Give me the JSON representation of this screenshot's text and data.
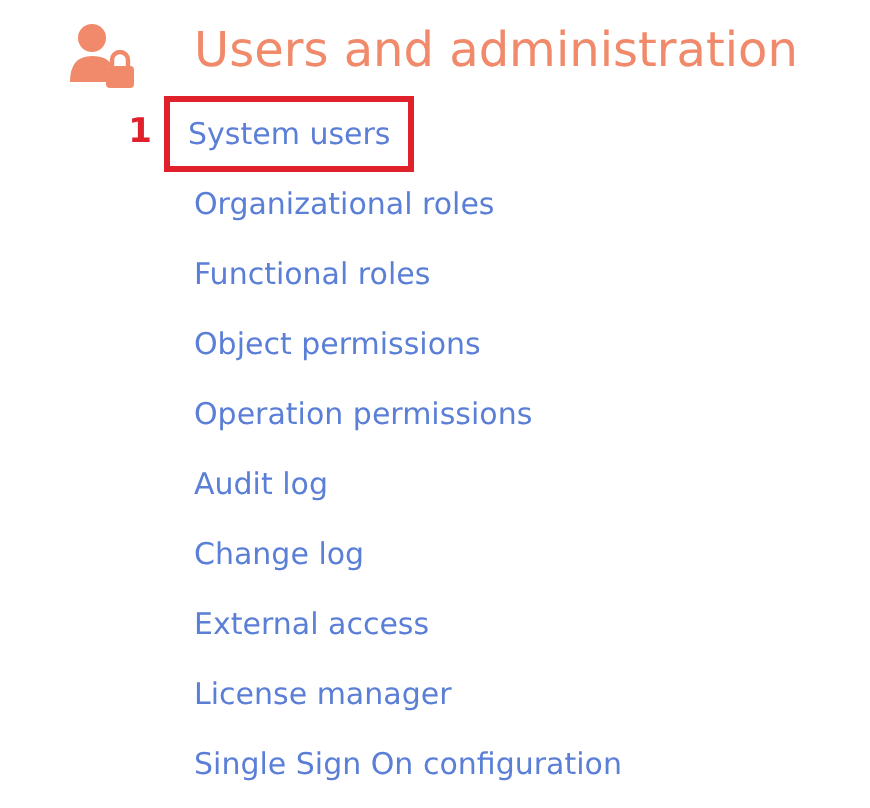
{
  "section": {
    "title": "Users and administration"
  },
  "links": [
    {
      "label": "System users",
      "highlighted": true,
      "callout": "1"
    },
    {
      "label": "Organizational roles",
      "highlighted": false
    },
    {
      "label": "Functional roles",
      "highlighted": false
    },
    {
      "label": "Object permissions",
      "highlighted": false
    },
    {
      "label": "Operation permissions",
      "highlighted": false
    },
    {
      "label": "Audit log",
      "highlighted": false
    },
    {
      "label": "Change log",
      "highlighted": false
    },
    {
      "label": "External access",
      "highlighted": false
    },
    {
      "label": "License manager",
      "highlighted": false
    },
    {
      "label": "Single Sign On configuration",
      "highlighted": false
    }
  ]
}
